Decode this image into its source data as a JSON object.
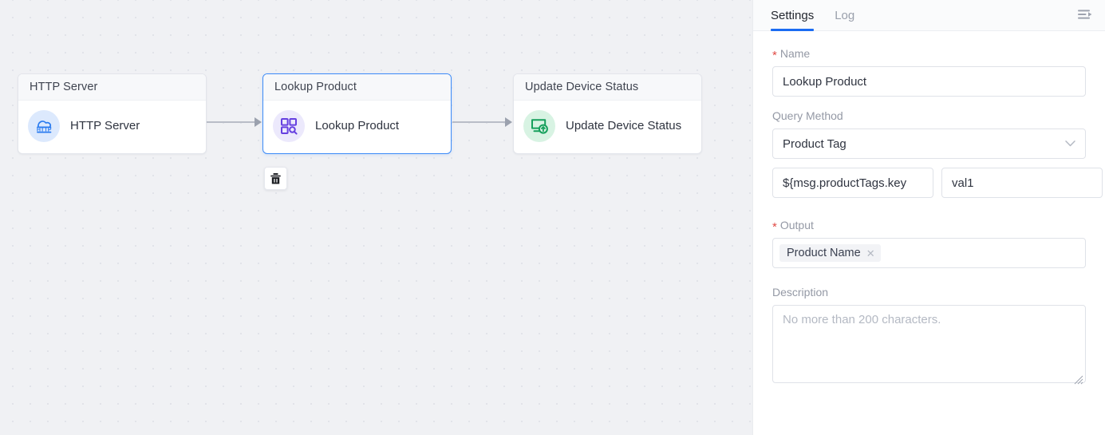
{
  "canvas": {
    "nodes": [
      {
        "id": "http-server",
        "header": "HTTP Server",
        "label": "HTTP Server",
        "icon": "http-cloud-icon",
        "icon_text": "HTTP",
        "accent": "#2b7cf0",
        "icon_bg": "#dce9fd",
        "selected": false
      },
      {
        "id": "lookup-product",
        "header": "Lookup Product",
        "label": "Lookup Product",
        "icon": "grid-search-icon",
        "accent": "#6640e0",
        "icon_bg": "#ece9fc",
        "selected": true
      },
      {
        "id": "update-device-status",
        "header": "Update Device Status",
        "label": "Update Device Status",
        "icon": "monitor-upload-icon",
        "accent": "#16a05c",
        "icon_bg": "#d8f3e3",
        "selected": false
      }
    ],
    "toolbar": {
      "delete_icon": "trash-icon",
      "delete_label": "Delete"
    }
  },
  "panel": {
    "tabs": [
      {
        "id": "settings",
        "label": "Settings",
        "active": true
      },
      {
        "id": "log",
        "label": "Log",
        "active": false
      }
    ],
    "collapse_icon": "collapse-panel-icon",
    "accent_color": "#1b6cf2",
    "fields": {
      "name": {
        "label": "Name",
        "required": true,
        "value": "Lookup Product",
        "placeholder": ""
      },
      "query_method": {
        "label": "Query Method",
        "required": false,
        "value": "Product Tag",
        "chevron": "chevron-down-icon"
      },
      "query_key": {
        "value": "${msg.productTags.key",
        "placeholder": ""
      },
      "query_value": {
        "value": "val1",
        "placeholder": ""
      },
      "output": {
        "label": "Output",
        "required": true,
        "tags": [
          {
            "label": "Product Name",
            "remove_icon": "close-icon"
          }
        ]
      },
      "description": {
        "label": "Description",
        "required": false,
        "value": "",
        "placeholder": "No more than 200 characters."
      }
    }
  }
}
